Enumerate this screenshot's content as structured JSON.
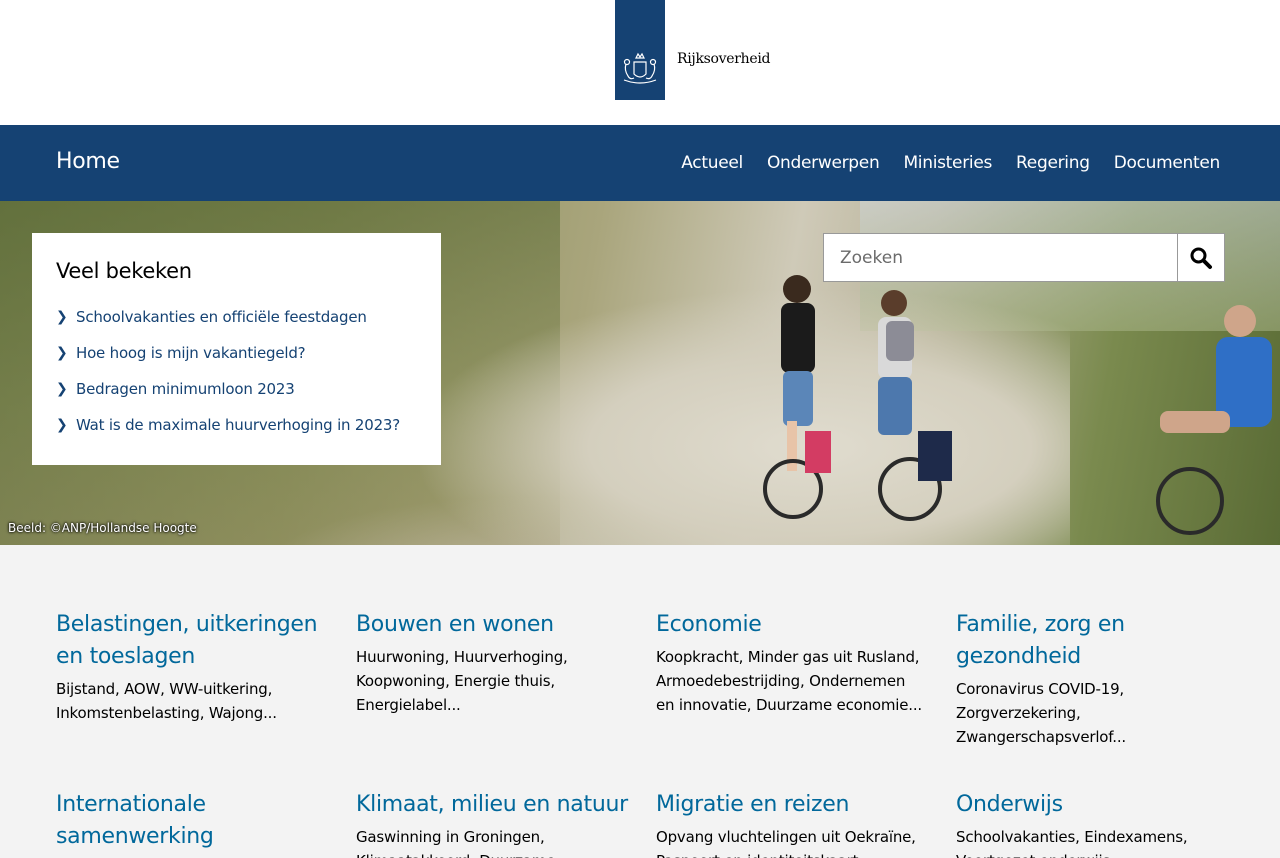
{
  "header": {
    "logo_text": "Rijksoverheid"
  },
  "nav": {
    "home": "Home",
    "links": [
      "Actueel",
      "Onderwerpen",
      "Ministeries",
      "Regering",
      "Documenten"
    ]
  },
  "search": {
    "placeholder": "Zoeken"
  },
  "popular": {
    "title": "Veel bekeken",
    "items": [
      "Schoolvakanties en officiële feestdagen",
      "Hoe hoog is mijn vakantiegeld?",
      "Bedragen minimumloon 2023",
      "Wat is de maximale huurverhoging in 2023?"
    ]
  },
  "hero": {
    "credit": "Beeld: ©ANP/Hollandse Hoogte"
  },
  "topics": [
    {
      "title": "Belastingen, uitkeringen en toeslagen",
      "desc": "Bijstand, AOW, WW-uitkering, Inkomstenbelasting, Wajong..."
    },
    {
      "title": "Bouwen en wonen",
      "desc": "Huurwoning, Huurverhoging, Koopwoning, Energie thuis, Energielabel..."
    },
    {
      "title": "Economie",
      "desc": "Koopkracht, Minder gas uit Rusland, Armoedebestrijding, Ondernemen en innovatie, Duurzame economie..."
    },
    {
      "title": "Familie, zorg en gezondheid",
      "desc": "Coronavirus COVID-19, Zorgverzekering, Zwangerschapsverlof..."
    },
    {
      "title": "Internationale samenwerking",
      "desc": ""
    },
    {
      "title": "Klimaat, milieu en natuur",
      "desc": "Gaswinning in Groningen, Klimaatakkoord, Duurzame energie..."
    },
    {
      "title": "Migratie en reizen",
      "desc": "Opvang vluchtelingen uit Oekraïne, Paspoort en identiteitskaart..."
    },
    {
      "title": "Onderwijs",
      "desc": "Schoolvakanties, Eindexamens, Voortgezet onderwijs, Basisonderwijs..."
    }
  ]
}
